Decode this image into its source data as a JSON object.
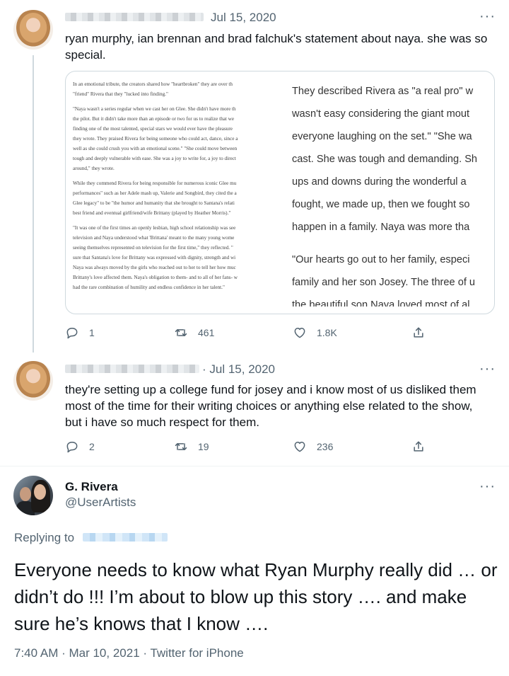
{
  "tweet1": {
    "date": "Jul 15, 2020",
    "more": "···",
    "text": "ryan murphy, ian brennan and brad falchuk's statement about naya. she was so special.",
    "media": {
      "left_lines": [
        "In an emotional tribute, the creators shared how \"heartbroken\" they are over th",
        "\"friend\" Rivera that they \"lucked into finding.\"",
        "\"Naya wasn't a series regular when we cast her on Glee. She didn't have more th",
        "the pilot. But it didn't take more than an episode or two for us to realize that we",
        "finding one of the most talented, special stars we would ever have the pleasure",
        "they wrote. They praised Rivera for being someone who could act, dance, since a",
        "well as she could crush you with an emotional scene.\" \"She could move between",
        "tough and deeply vulnerable with ease. She was a joy to write for, a joy to direct",
        "around,\" they wrote.",
        "While they commend Rivera for being responsible for numerous iconic Glee mu",
        "performances\" such as her Adele mash up, Valerie and Songbird, they cited the a",
        "Glee legacy\" to be \"the humor and humanity that she brought to Santana's relati",
        "best friend and eventual girlfriend/wife Brittany (played by Heather Morris).\"",
        "\"It was one of the first times an openly lesbian, high school relationship was see",
        "television and Naya understood what 'Brittana' meant to the many young wome",
        "seeing themselves represented on television for the first time,\" they reflected. \"",
        "sure that Santana's love for Brittany was expressed with dignity, strength and wi",
        "Naya was always moved by the girls who reached out to her to tell her how muc",
        "Brittany's love affected them. Naya's obligation to them- and to all of her fans- w",
        "had the rare combination of humility and endless confidence in her talent.\""
      ],
      "right_lines": [
        "They described Rivera as \"a real pro\" w",
        "wasn't easy considering the giant mout",
        "everyone laughing on the set.\" \"She wa",
        "cast. She was tough and demanding. Sh",
        "ups and downs during the wonderful a",
        "fought, we made up, then we fought so",
        "happen in a family. Naya was more tha",
        "\"Our hearts go out to her family, especi",
        "family and her son Josey. The three of u",
        "the beautiful son Naya loved most of al"
      ]
    },
    "replies": "1",
    "retweets": "461",
    "likes": "1.8K"
  },
  "tweet2": {
    "date": "· Jul 15, 2020",
    "more": "···",
    "text": "they're setting up a college fund for josey and i know most of us disliked them most of the time for their writing choices or anything else related to the show, but i have so much respect for them.",
    "replies": "2",
    "retweets": "19",
    "likes": "236"
  },
  "main_tweet": {
    "name": "G. Rivera",
    "handle": "@UserArtists",
    "more": "···",
    "replying_to": "Replying to",
    "text": "Everyone needs to know what Ryan Murphy really did … or didn’t do !!! I’m about to blow up this story …. and make sure he’s knows that I know ….",
    "footer": "7:40 AM · Mar 10, 2021 · Twitter for iPhone"
  },
  "icons": [
    "reply-icon",
    "retweet-icon",
    "like-icon",
    "share-icon",
    "more-icon"
  ],
  "colors": {
    "text": "#0f1419",
    "secondary": "#536471",
    "divider": "#eff3f4"
  }
}
